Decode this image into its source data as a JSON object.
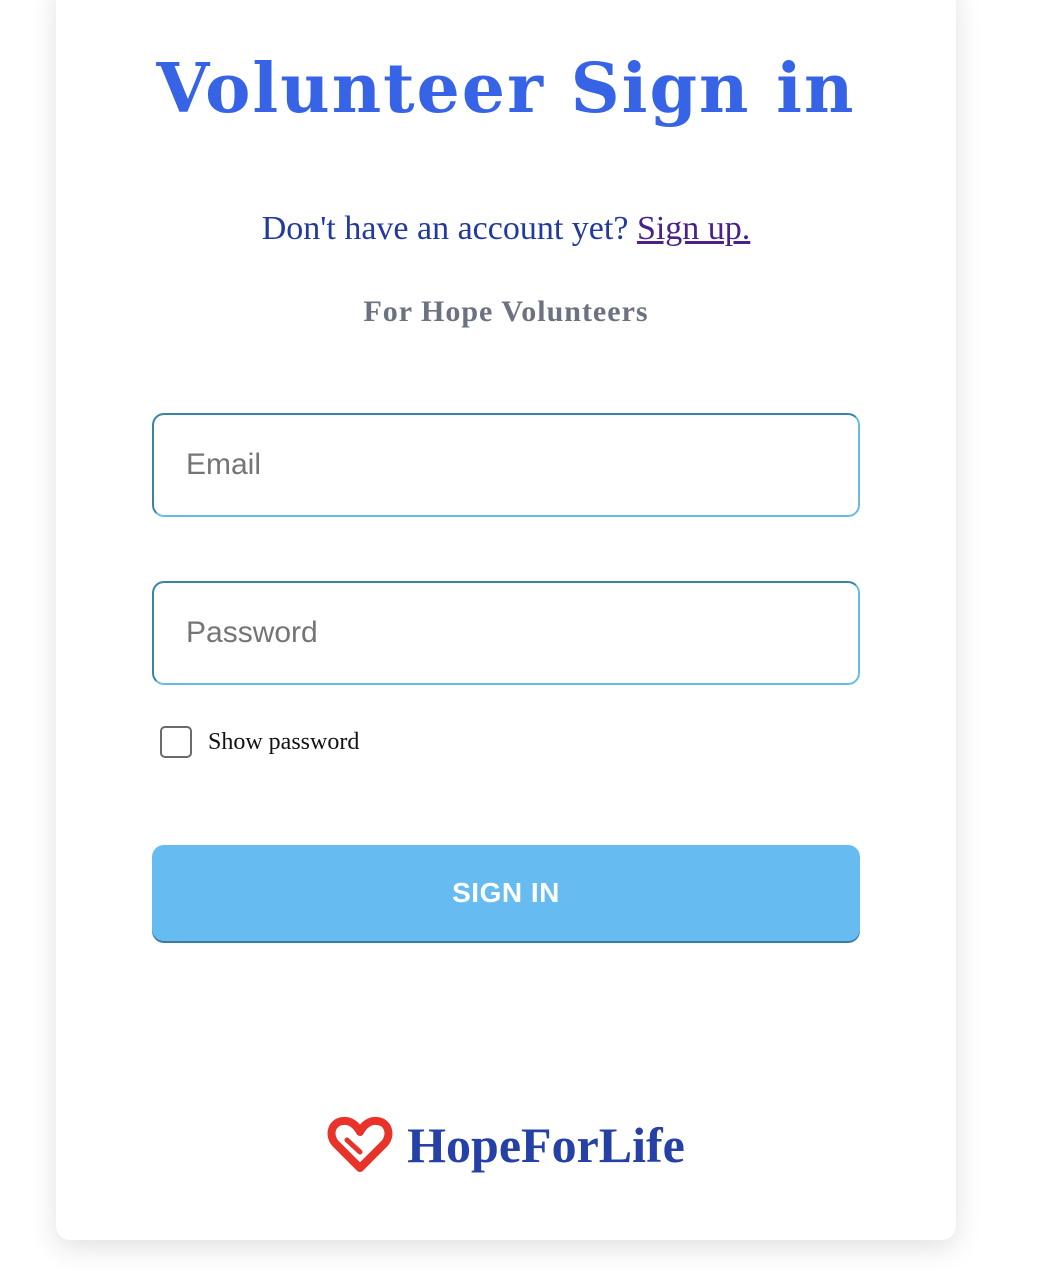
{
  "login": {
    "title": "Volunteer Sign in",
    "signup_prompt": "Don't have an account yet?",
    "signup_link": "Sign up.",
    "subtitle": "For Hope Volunteers",
    "email_placeholder": "Email",
    "password_placeholder": "Password",
    "show_password_label": "Show password",
    "show_password_checked": false,
    "submit_label": "SIGN IN"
  },
  "brand": {
    "name": "HopeForLife",
    "logo_icon": "heart-logo-icon"
  },
  "colors": {
    "title": "#3763e6",
    "text": "#223a9c",
    "link": "#4a2287",
    "subtitle": "#6b7280",
    "button": "#66bbf1",
    "logo": "#e8332a",
    "brand_text": "#2540a6"
  }
}
